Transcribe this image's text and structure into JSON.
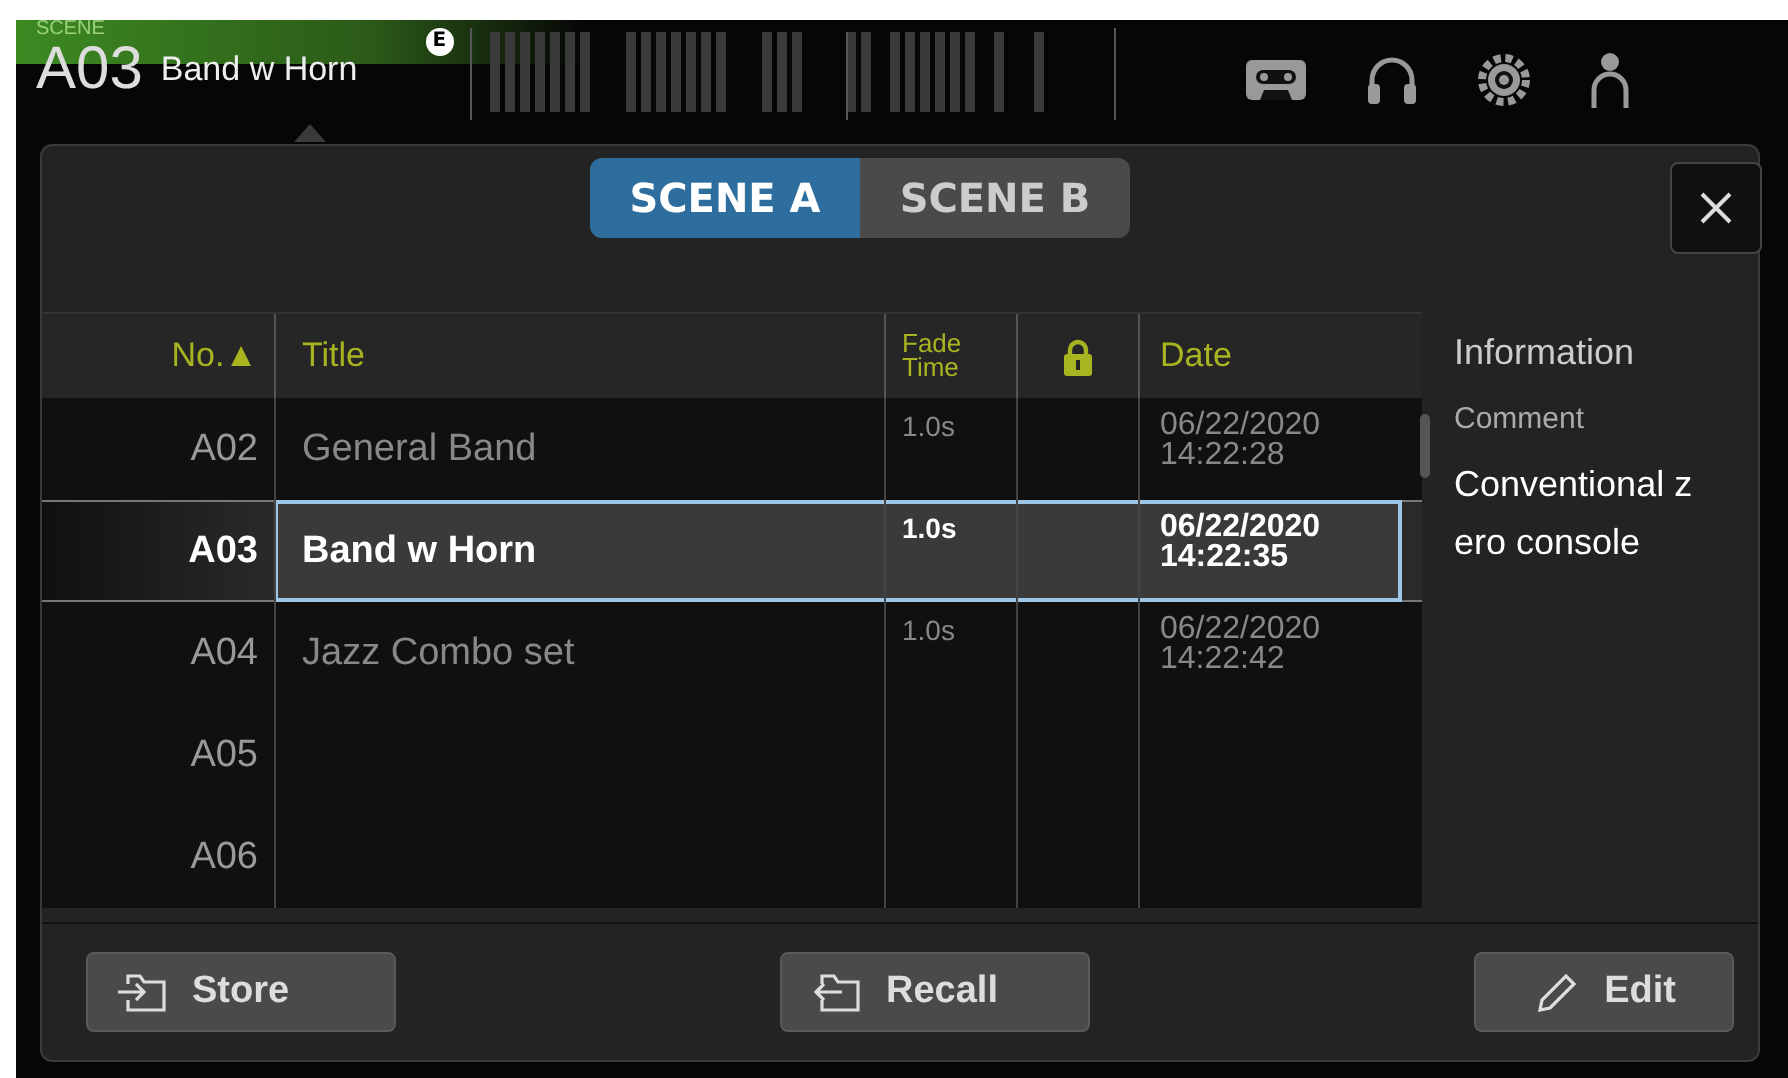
{
  "header": {
    "scene_label": "SCENE",
    "scene_number": "A03",
    "scene_title": "Band w Horn",
    "badge": "E"
  },
  "tabs": [
    {
      "label": "SCENE A",
      "selected": true
    },
    {
      "label": "SCENE B",
      "selected": false
    }
  ],
  "table": {
    "columns": [
      {
        "label": "No.▲",
        "kind": "text"
      },
      {
        "label": "Title",
        "kind": "text"
      },
      {
        "label": "Fade Time",
        "kind": "text"
      },
      {
        "kind": "icon"
      },
      {
        "label": "Date",
        "kind": "text"
      }
    ],
    "rows": [
      {
        "no": "A02",
        "title": "General Band",
        "fade_time": "1.0s",
        "date": "06/22/2020",
        "time": "14:22:28",
        "selected": false
      },
      {
        "no": "A03",
        "title": "Band w Horn",
        "fade_time": "1.0s",
        "date": "06/22/2020",
        "time": "14:22:35",
        "selected": true
      },
      {
        "no": "A04",
        "title": "Jazz Combo set",
        "fade_time": "1.0s",
        "date": "06/22/2020",
        "time": "14:22:42",
        "selected": false
      },
      {
        "no": "A05",
        "selected": false
      },
      {
        "no": "A06",
        "selected": false
      }
    ]
  },
  "information": {
    "heading": "Information",
    "comment_label": "Comment",
    "comment": "Conventional zero console"
  },
  "buttons": [
    {
      "label": "Store",
      "kind": "store"
    },
    {
      "label": "Recall",
      "kind": "recall"
    },
    {
      "label": "Edit",
      "kind": "edit"
    }
  ]
}
